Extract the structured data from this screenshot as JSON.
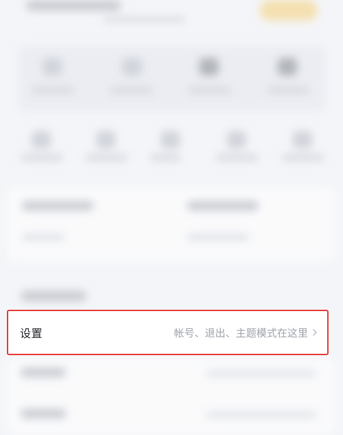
{
  "settings_row": {
    "title": "设置",
    "hint": "帐号、退出、主题模式在这里"
  },
  "icons": {
    "chevron": "chevron-right-icon"
  },
  "colors": {
    "highlight_border": "#e53935",
    "hint_text": "#9ea3ab",
    "title_text": "#1f2126",
    "page_background": "#f4f5f8"
  }
}
